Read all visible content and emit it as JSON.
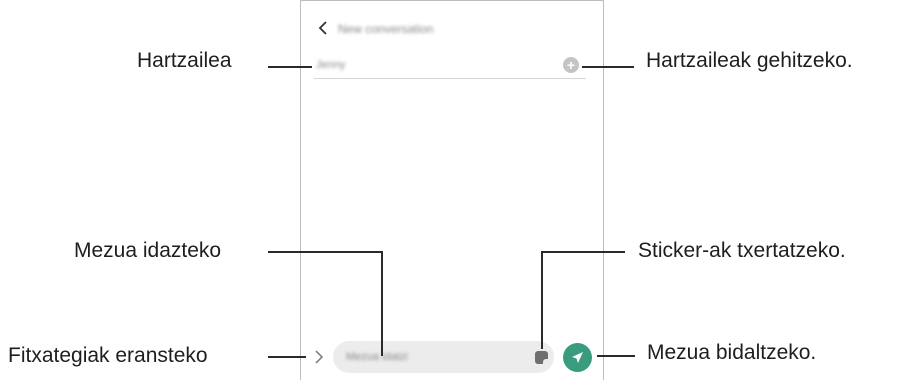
{
  "screen": {
    "header_title": "New conversation",
    "recipient_value": "Jenny",
    "compose_placeholder": "Mezua idatzi"
  },
  "icons": {
    "back": "chevron-left-icon",
    "add_recipient": "plus-circle-icon",
    "attach": "chevron-right-icon",
    "sticker": "sticker-icon",
    "send": "send-icon"
  },
  "colors": {
    "send_button": "#3a9c7f",
    "compose_bg": "#ececec",
    "add_button": "#c4c4c4"
  },
  "callouts": {
    "recipient": "Hartzailea",
    "add_recipients": "Hartzaileak gehitzeko.",
    "write_message": "Mezua idazteko",
    "insert_stickers": "Sticker-ak txertatzeko.",
    "attach_files": "Fitxategiak eransteko",
    "send_message": "Mezua bidaltzeko."
  }
}
